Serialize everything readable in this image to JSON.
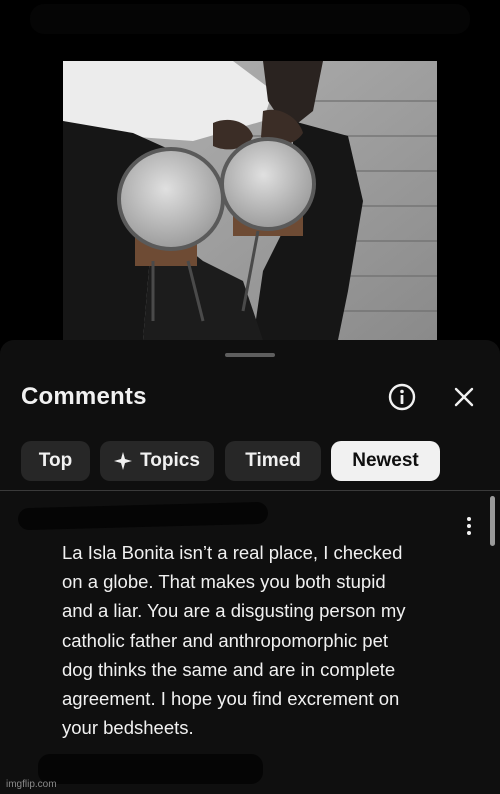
{
  "comments_panel": {
    "title": "Comments",
    "info_icon": "info-circle-icon",
    "close_icon": "close-icon"
  },
  "sort_chips": [
    {
      "label": "Top",
      "active": false
    },
    {
      "label": "Topics",
      "active": false,
      "icon": "sparkle-icon"
    },
    {
      "label": "Timed",
      "active": false
    },
    {
      "label": "Newest",
      "active": true
    }
  ],
  "comment": {
    "text": "La Isla Bonita isn’t a real place, I checked\non a globe. That makes you both stupid\nand a liar. You are a disgusting person my\ncatholic father and anthropomorphic pet\ndog thinks the same and are in complete\nagreement. I hope you find excrement on\nyour bedsheets.",
    "more_icon": "more-vertical-icon"
  },
  "watermark": "imgflip.com",
  "colors": {
    "sheet_background": "#0f0f0f",
    "chip_background": "#272727",
    "active_chip_background": "#f1f1f1",
    "text_primary": "#f1f1f1"
  }
}
